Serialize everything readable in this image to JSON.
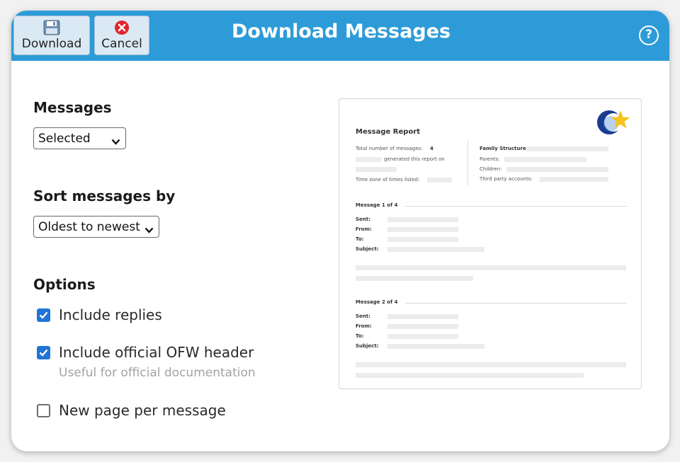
{
  "window": {
    "title": "Download Messages",
    "help_icon": "help-circle-icon",
    "help_glyph": "?"
  },
  "toolbar": {
    "download_label": "Download",
    "download_icon": "floppy-disk-icon",
    "cancel_label": "Cancel",
    "cancel_icon": "red-x-circle-icon"
  },
  "form": {
    "messages": {
      "heading": "Messages",
      "value": "Selected"
    },
    "sort": {
      "heading": "Sort messages by",
      "value": "Oldest to newest"
    },
    "options": {
      "heading": "Options",
      "items": [
        {
          "label": "Include replies",
          "checked": true
        },
        {
          "label": "Include official OFW header",
          "checked": true,
          "hint": "Useful for official documentation"
        },
        {
          "label": "New page per message",
          "checked": false
        }
      ]
    }
  },
  "preview": {
    "logo": "ofw-logo-icon",
    "report_title": "Message Report",
    "total_label": "Total number of messages:",
    "total_value": "4",
    "generated_text": "generated this report on",
    "timezone_label": "Time zone of times listed:",
    "family_structure_label": "Family Structure:",
    "parents_label": "Parents:",
    "children_label": "Children:",
    "third_party_label": "Third party accounts:",
    "messages": [
      {
        "header": "Message 1 of 4",
        "sent": "Sent:",
        "from": "From:",
        "to": "To:",
        "subject": "Subject:"
      },
      {
        "header": "Message 2 of 4",
        "sent": "Sent:",
        "from": "From:",
        "to": "To:",
        "subject": "Subject:"
      }
    ]
  },
  "colors": {
    "titlebar": "#2d9bd7",
    "checkbox_checked": "#1f74d6",
    "cancel_icon": "#e0262d",
    "logo_blue": "#1a3b8f",
    "logo_star": "#f6c21c"
  }
}
